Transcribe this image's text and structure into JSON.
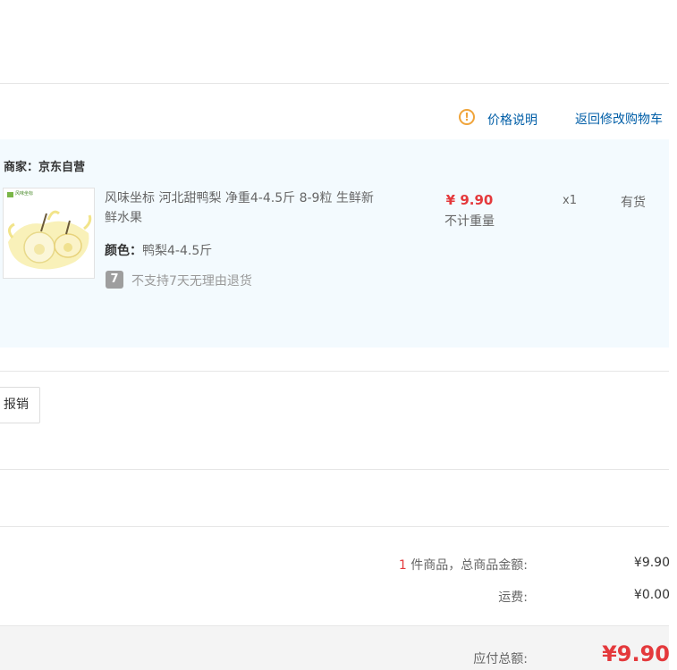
{
  "price_notes": {
    "explain_link": "价格说明",
    "back_to_cart": "返回修改购物车"
  },
  "shop": {
    "seller_label": "商家：",
    "seller_name": "京东自营",
    "item": {
      "title": "风味坐标 河北甜鸭梨 净重4-4.5斤 8-9粒 生鲜新鲜水果",
      "attr_label": "颜色：",
      "attr_value": "鸭梨4-4.5斤",
      "no_return_icon": "7",
      "no_return_text": "不支持7天无理由退货",
      "price": "¥ 9.90",
      "weight_note": "不计重量",
      "quantity": "x1",
      "stock": "有货",
      "brand_tiny": "风味坐标"
    }
  },
  "invoice": {
    "button_label": "报销"
  },
  "summary": {
    "count": "1",
    "count_label": " 件商品，总商品金额:",
    "goods_total": "¥9.90",
    "shipping_label": "运费:",
    "shipping": "¥0.00",
    "pay_label": "应付总额:",
    "pay_total": "¥9.90"
  },
  "colors": {
    "accent_red": "#e4393c",
    "link_blue": "#005ea7",
    "warn_orange": "#f0a43a",
    "shop_bg": "#f3fafe"
  },
  "icons": {
    "price_explain": "warning-circle-icon",
    "no_return": "no-7day-return-icon"
  }
}
